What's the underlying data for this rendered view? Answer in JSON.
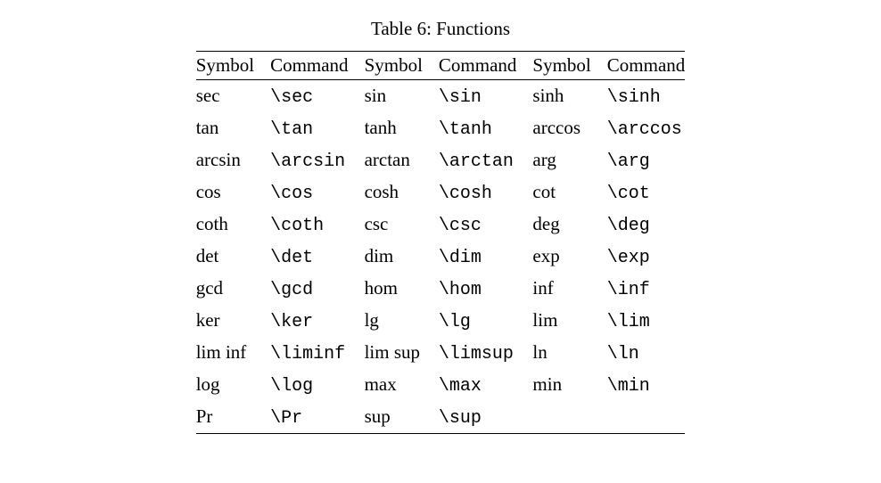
{
  "caption": "Table 6: Functions",
  "headers": [
    "Symbol",
    "Command",
    "Symbol",
    "Command",
    "Symbol",
    "Command"
  ],
  "chart_data": {
    "type": "table",
    "title": "Table 6: Functions",
    "headers": [
      "Symbol",
      "Command",
      "Symbol",
      "Command",
      "Symbol",
      "Command"
    ],
    "rows": [
      [
        "sec",
        "\\sec",
        "sin",
        "\\sin",
        "sinh",
        "\\sinh"
      ],
      [
        "tan",
        "\\tan",
        "tanh",
        "\\tanh",
        "arccos",
        "\\arccos"
      ],
      [
        "arcsin",
        "\\arcsin",
        "arctan",
        "\\arctan",
        "arg",
        "\\arg"
      ],
      [
        "cos",
        "\\cos",
        "cosh",
        "\\cosh",
        "cot",
        "\\cot"
      ],
      [
        "coth",
        "\\coth",
        "csc",
        "\\csc",
        "deg",
        "\\deg"
      ],
      [
        "det",
        "\\det",
        "dim",
        "\\dim",
        "exp",
        "\\exp"
      ],
      [
        "gcd",
        "\\gcd",
        "hom",
        "\\hom",
        "inf",
        "\\inf"
      ],
      [
        "ker",
        "\\ker",
        "lg",
        "\\lg",
        "lim",
        "\\lim"
      ],
      [
        "lim inf",
        "\\liminf",
        "lim sup",
        "\\limsup",
        "ln",
        "\\ln"
      ],
      [
        "log",
        "\\log",
        "max",
        "\\max",
        "min",
        "\\min"
      ],
      [
        "Pr",
        "\\Pr",
        "sup",
        "\\sup",
        "",
        ""
      ]
    ]
  }
}
